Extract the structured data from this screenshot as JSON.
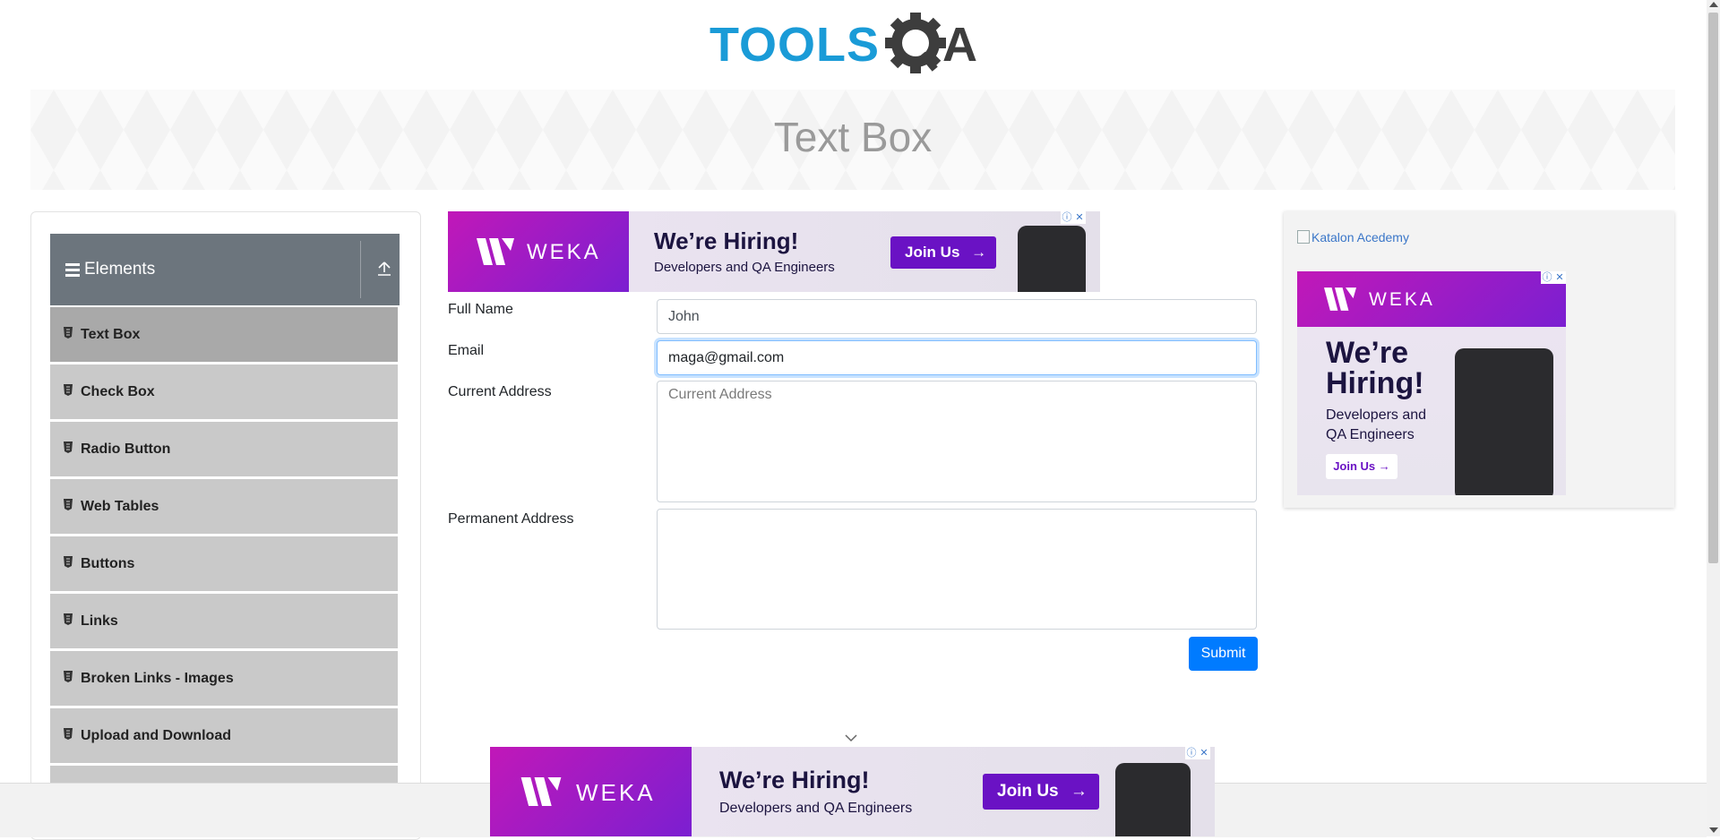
{
  "header": {
    "logo_text_left": "TOOLS",
    "logo_text_right": "A",
    "logo_icon": "gear-magnifier-icon",
    "colors": {
      "brand_blue": "#1a9bd7",
      "brand_dark": "#3d3d3d"
    }
  },
  "banner": {
    "title": "Text Box"
  },
  "sidebar": {
    "group_title": "Elements",
    "group_icon": "hamburger-icon",
    "collapse_icon": "upload-arrow-icon",
    "items": [
      {
        "label": "Text Box",
        "active": true
      },
      {
        "label": "Check Box"
      },
      {
        "label": "Radio Button"
      },
      {
        "label": "Web Tables"
      },
      {
        "label": "Buttons"
      },
      {
        "label": "Links"
      },
      {
        "label": "Broken Links - Images"
      },
      {
        "label": "Upload and Download"
      }
    ]
  },
  "form": {
    "full_name_label": "Full Name",
    "full_name_value": "John",
    "email_label": "Email",
    "email_value": "maga@gmail.com",
    "current_address_label": "Current Address",
    "current_address_placeholder": "Current Address",
    "permanent_address_label": "Permanent Address",
    "submit_label": "Submit",
    "colors": {
      "primary": "#007bff"
    }
  },
  "ads": {
    "brand": "WEKA",
    "headline": "We’re Hiring!",
    "subline": "Developers and QA Engineers",
    "subline_line1": "Developers and",
    "subline_line2": "QA Engineers",
    "headline_line1": "We’re",
    "headline_line2": "Hiring!",
    "cta": "Join Us",
    "close": "✕",
    "info": "ⓘ",
    "colors": {
      "purple": "#6a12c4",
      "magenta": "#c118b8"
    }
  },
  "right_ad": {
    "broken_image_alt": "Katalon Acedemy"
  }
}
